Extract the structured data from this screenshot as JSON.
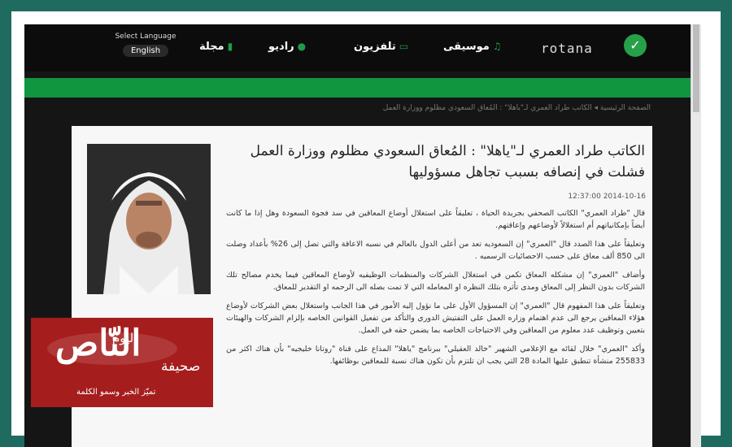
{
  "colors": {
    "frame": "#1f6b60",
    "accent_green": "#119640",
    "nav_bg": "#0c0c0c",
    "badge_red": "#a51d1d"
  },
  "topnav": {
    "language": {
      "label": "Select Language",
      "value": "English"
    },
    "items": [
      {
        "label": "مجلة",
        "icon": "phone-icon"
      },
      {
        "label": "راديو",
        "icon": "microphone-icon"
      },
      {
        "label": "تلفزيون",
        "icon": "tv-icon"
      },
      {
        "label": "موسيقى",
        "icon": "music-note-icon"
      }
    ],
    "logo_text": "rotana"
  },
  "breadcrumb": "الصفحة الرئيسية ◂ الكاتب طراد العمري لـ\"ياهلا\" : المُعاق السعودي مظلوم ووزارة العمل فشلت في إنصافه بسبب تجاهل مسؤوليها",
  "article": {
    "title": "الكاتب طراد العمري لـ\"ياهلا\" : المُعاق السعودي مظلوم ووزارة العمل فشلت في إنصافه بسبب تجاهل مسؤوليها",
    "date": "12:37:00 2014-10-16",
    "paragraphs": [
      "قال \"طراد العمري\" الكاتب الصحفي بجريدة الحياة ، تعليقاً على استغلال أوضاع المعاقين في سد فجوة السعودة وهل إذا ما كانت أيضاً بإمكانياتهم أم استغلالاً لأوضاعهم وإعاقتهم.",
      "وتعليقاً على هذا الصدد قال \"العمري\" إن السعوديه تعد من أعلى الدول بالعالم في نسبه الاعاقة والتي تصل إلى 26% بأعداد وصلت الى 850 ألف معاق على حسب الاحصائيات الرسميه .",
      "وأضاف \"العمري\" إن مشكله المعاق تكمن في استغلال الشركات والمنظمات الوظيفيه لأوضاع المعاقين فيما يخدم مصالح تلك الشركات بدون النظر إلى المعاق ومدى تأثره بتلك النظره او المعامله التي لا تمت بصله الى الرحمه او التقدير للمعاق.",
      "وتعليقاً على هذا المفهوم قال \"العمري\" إن المسؤول الأول على ما نؤول إليه الأمور في هذا الجانب واستغلال بعض الشركات لأوضاع هؤلاء المعاقين يرجع الى عدم اهتمام وزاره العمل على التفتيش الدوري والتأكد من تفعيل القوانين الخاصه بإلزام الشركات والهيئات بتعيين وتوظيف عدد معلوم من المعاقين وفي الاحتياجات الخاصه بما يضمن حقه في العمل.",
      "وأكد \"العمري\" خلال لقائه مع الإعلامي الشهير \"خالد العقيلي\" ببرنامج \"ياهلا\" المذاع على قناة \"روتانا خليجيه\" بأن هناك اكثر من 255833 منشأة تنطبق عليها المادة 28 التي يجب ان تلتزم بأن تكون هناك نسبة للمعاقين بوظائفها."
    ]
  },
  "badge": {
    "name": "النّاص",
    "today": "اليوم",
    "paper": "صحيفة",
    "tagline": "تميّز الخبر وسمو الكلمة"
  }
}
